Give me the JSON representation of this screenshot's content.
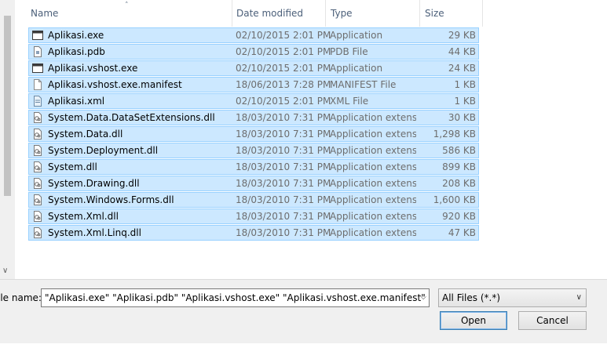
{
  "columns": {
    "name": "Name",
    "date_modified": "Date modified",
    "type": "Type",
    "size": "Size"
  },
  "files": [
    {
      "name": "Aplikasi.exe",
      "date": "02/10/2015 2:01 PM",
      "type": "Application",
      "size": "29 KB",
      "icon": "application-exe-icon"
    },
    {
      "name": "Aplikasi.pdb",
      "date": "02/10/2015 2:01 PM",
      "type": "PDB File",
      "size": "44 KB",
      "icon": "pdb-file-icon"
    },
    {
      "name": "Aplikasi.vshost.exe",
      "date": "02/10/2015 2:01 PM",
      "type": "Application",
      "size": "24 KB",
      "icon": "application-exe-icon"
    },
    {
      "name": "Aplikasi.vshost.exe.manifest",
      "date": "18/06/2013 7:28 PM",
      "type": "MANIFEST File",
      "size": "1 KB",
      "icon": "blank-file-icon"
    },
    {
      "name": "Aplikasi.xml",
      "date": "02/10/2015 2:01 PM",
      "type": "XML File",
      "size": "1 KB",
      "icon": "xml-file-icon"
    },
    {
      "name": "System.Data.DataSetExtensions.dll",
      "date": "18/03/2010 7:31 PM",
      "type": "Application extens...",
      "size": "30 KB",
      "icon": "dll-file-icon"
    },
    {
      "name": "System.Data.dll",
      "date": "18/03/2010 7:31 PM",
      "type": "Application extens...",
      "size": "1,298 KB",
      "icon": "dll-file-icon"
    },
    {
      "name": "System.Deployment.dll",
      "date": "18/03/2010 7:31 PM",
      "type": "Application extens...",
      "size": "586 KB",
      "icon": "dll-file-icon"
    },
    {
      "name": "System.dll",
      "date": "18/03/2010 7:31 PM",
      "type": "Application extens...",
      "size": "899 KB",
      "icon": "dll-file-icon"
    },
    {
      "name": "System.Drawing.dll",
      "date": "18/03/2010 7:31 PM",
      "type": "Application extens...",
      "size": "208 KB",
      "icon": "dll-file-icon"
    },
    {
      "name": "System.Windows.Forms.dll",
      "date": "18/03/2010 7:31 PM",
      "type": "Application extens...",
      "size": "1,600 KB",
      "icon": "dll-file-icon"
    },
    {
      "name": "System.Xml.dll",
      "date": "18/03/2010 7:31 PM",
      "type": "Application extens...",
      "size": "920 KB",
      "icon": "dll-file-icon"
    },
    {
      "name": "System.Xml.Linq.dll",
      "date": "18/03/2010 7:31 PM",
      "type": "Application extens...",
      "size": "47 KB",
      "icon": "dll-file-icon"
    }
  ],
  "footer": {
    "filename_label": "ile name:",
    "filename_value": "\"Aplikasi.exe\" \"Aplikasi.pdb\" \"Aplikasi.vshost.exe\" \"Aplikasi.vshost.exe.manifest\" \"Aplikasi.",
    "filter_value": "All Files (*.*)",
    "open_label": "Open",
    "cancel_label": "Cancel"
  },
  "colors": {
    "selection_bg": "#cce8ff",
    "selection_border": "#99d1ff",
    "header_text": "#4c607a"
  }
}
